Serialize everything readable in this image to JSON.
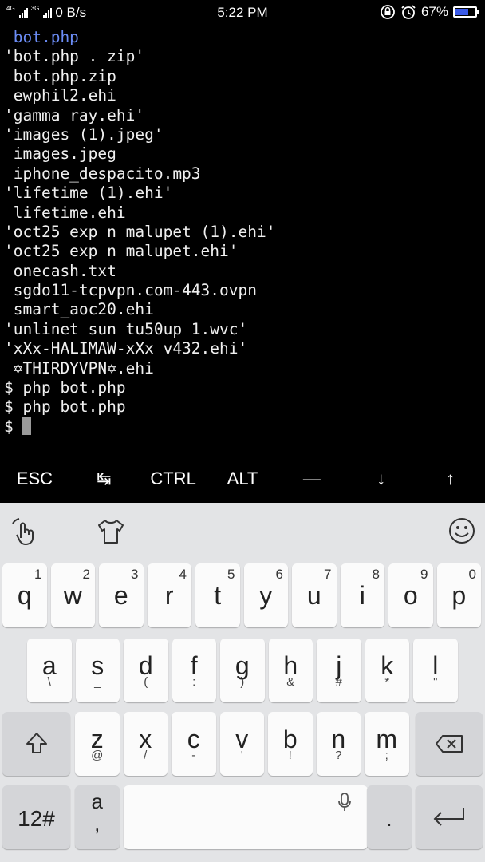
{
  "status_bar": {
    "network_1": "4G",
    "network_2": "3G",
    "data_rate": "0 B/s",
    "time": "5:22 PM",
    "battery_percent": "67%",
    "battery_level": 0.67,
    "icons": [
      "rotation-lock-icon",
      "alarm-icon",
      "battery-icon"
    ]
  },
  "terminal": {
    "lines": [
      {
        "text": " bot.php",
        "type": "dir"
      },
      {
        "text": "'bot.php . zip'",
        "type": "file"
      },
      {
        "text": " bot.php.zip",
        "type": "file"
      },
      {
        "text": " ewphil2.ehi",
        "type": "file"
      },
      {
        "text": "'gamma ray.ehi'",
        "type": "file"
      },
      {
        "text": "'images (1).jpeg'",
        "type": "file"
      },
      {
        "text": " images.jpeg",
        "type": "file"
      },
      {
        "text": " iphone_despacito.mp3",
        "type": "file"
      },
      {
        "text": "'lifetime (1).ehi'",
        "type": "file"
      },
      {
        "text": " lifetime.ehi",
        "type": "file"
      },
      {
        "text": "'oct25 exp n malupet (1).ehi'",
        "type": "file"
      },
      {
        "text": "'oct25 exp n malupet.ehi'",
        "type": "file"
      },
      {
        "text": " onecash.txt",
        "type": "file"
      },
      {
        "text": " sgdo11-tcpvpn.com-443.ovpn",
        "type": "file"
      },
      {
        "text": " smart_aoc20.ehi",
        "type": "file"
      },
      {
        "text": "'unlinet sun tu50up 1.wvc'",
        "type": "file"
      },
      {
        "text": "'xXx-HALIMAW-xXx v432.ehi'",
        "type": "file"
      },
      {
        "text": " ✡THIRDYVPN✡.ehi",
        "type": "file"
      },
      {
        "text": "$ php bot.php",
        "type": "cmd"
      },
      {
        "text": "$ php bot.php",
        "type": "cmd"
      }
    ],
    "prompt": "$ "
  },
  "extra_keys": [
    {
      "label": "ESC",
      "name": "esc-key"
    },
    {
      "label": "↹",
      "name": "tab-key"
    },
    {
      "label": "CTRL",
      "name": "ctrl-key"
    },
    {
      "label": "ALT",
      "name": "alt-key"
    },
    {
      "label": "—",
      "name": "dash-key"
    },
    {
      "label": "↓",
      "name": "down-arrow-key"
    },
    {
      "label": "↑",
      "name": "up-arrow-key"
    }
  ],
  "keyboard": {
    "row1": [
      {
        "main": "q",
        "hint": "1"
      },
      {
        "main": "w",
        "hint": "2"
      },
      {
        "main": "e",
        "hint": "3"
      },
      {
        "main": "r",
        "hint": "4"
      },
      {
        "main": "t",
        "hint": "5"
      },
      {
        "main": "y",
        "hint": "6"
      },
      {
        "main": "u",
        "hint": "7"
      },
      {
        "main": "i",
        "hint": "8"
      },
      {
        "main": "o",
        "hint": "9"
      },
      {
        "main": "p",
        "hint": "0"
      }
    ],
    "row2": [
      {
        "main": "a",
        "sub": "\\"
      },
      {
        "main": "s",
        "sub": "_"
      },
      {
        "main": "d",
        "sub": "("
      },
      {
        "main": "f",
        "sub": ":"
      },
      {
        "main": "g",
        "sub": ")"
      },
      {
        "main": "h",
        "sub": "&"
      },
      {
        "main": "j",
        "sub": "#"
      },
      {
        "main": "k",
        "sub": "*"
      },
      {
        "main": "l",
        "sub": "\""
      }
    ],
    "row3": [
      {
        "main": "z",
        "sub": "@"
      },
      {
        "main": "x",
        "sub": "/"
      },
      {
        "main": "c",
        "sub": "-"
      },
      {
        "main": "v",
        "sub": "'"
      },
      {
        "main": "b",
        "sub": "!"
      },
      {
        "main": "n",
        "sub": "?"
      },
      {
        "main": "m",
        "sub": ";"
      }
    ],
    "numbers_label": "12#",
    "punct_main": "a",
    "punct_sub": ",",
    "period_label": "."
  }
}
